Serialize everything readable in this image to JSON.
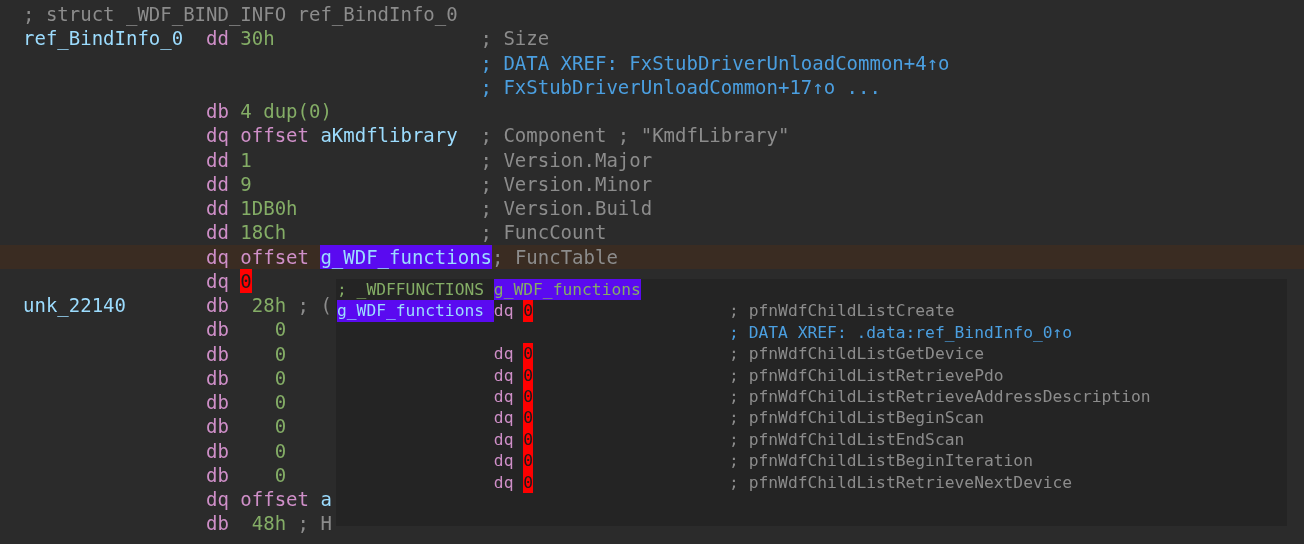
{
  "listing": {
    "lines": [
      {
        "label": {
          "text": "; struct _WDF_BIND_INFO ref_BindInfo_0",
          "kind": "comment"
        }
      },
      {
        "label": {
          "text": "ref_BindInfo_0",
          "kind": "label"
        },
        "mnemonic": "dd",
        "operands": [
          {
            "text": "30h",
            "kind": "number"
          }
        ],
        "comment": {
          "text": "; Size",
          "kind": "comment"
        }
      },
      {
        "comment": {
          "text": "; DATA XREF: FxStubDriverUnloadCommon+4↑o",
          "kind": "xref"
        }
      },
      {
        "comment": {
          "text": "; FxStubDriverUnloadCommon+17↑o ...",
          "kind": "xref"
        }
      },
      {
        "mnemonic": "db",
        "operands": [
          {
            "text": "4 dup(0)",
            "kind": "number"
          }
        ]
      },
      {
        "mnemonic": "dq",
        "operands": [
          {
            "text": "offset",
            "kind": "keyword"
          },
          {
            "text": "aKmdflibrary",
            "kind": "name"
          }
        ],
        "comment": {
          "text": "; Component ; \"KmdfLibrary\"",
          "kind": "comment"
        }
      },
      {
        "mnemonic": "dd",
        "operands": [
          {
            "text": "1",
            "kind": "number"
          }
        ],
        "comment": {
          "text": "; Version.Major",
          "kind": "comment"
        }
      },
      {
        "mnemonic": "dd",
        "operands": [
          {
            "text": "9",
            "kind": "number"
          }
        ],
        "comment": {
          "text": "; Version.Minor",
          "kind": "comment"
        }
      },
      {
        "mnemonic": "dd",
        "operands": [
          {
            "text": "1DB0h",
            "kind": "number"
          }
        ],
        "comment": {
          "text": "; Version.Build",
          "kind": "comment"
        }
      },
      {
        "mnemonic": "dd",
        "operands": [
          {
            "text": "18Ch",
            "kind": "number"
          }
        ],
        "comment": {
          "text": "; FuncCount",
          "kind": "comment"
        }
      },
      {
        "highlighted": true,
        "mnemonic": "dq",
        "operands": [
          {
            "text": "offset",
            "kind": "keyword"
          },
          {
            "text": "g_WDF_functions",
            "kind": "name",
            "selected": true
          }
        ],
        "comment": {
          "text": "; FuncTable",
          "kind": "comment"
        }
      },
      {
        "mnemonic": "dq",
        "operands": [
          {
            "text": "0",
            "kind": "error"
          }
        ]
      },
      {
        "label": {
          "text": "unk_22140",
          "kind": "label"
        },
        "mnemonic": "db",
        "operands": [
          {
            "text": "28h",
            "kind": "byte"
          },
          {
            "text": "; (",
            "kind": "comment"
          }
        ]
      },
      {
        "mnemonic": "db",
        "operands": [
          {
            "text": "0",
            "kind": "byte"
          }
        ]
      },
      {
        "mnemonic": "db",
        "operands": [
          {
            "text": "0",
            "kind": "byte"
          }
        ]
      },
      {
        "mnemonic": "db",
        "operands": [
          {
            "text": "0",
            "kind": "byte"
          }
        ]
      },
      {
        "mnemonic": "db",
        "operands": [
          {
            "text": "0",
            "kind": "byte"
          }
        ]
      },
      {
        "mnemonic": "db",
        "operands": [
          {
            "text": "0",
            "kind": "byte"
          }
        ]
      },
      {
        "mnemonic": "db",
        "operands": [
          {
            "text": "0",
            "kind": "byte"
          }
        ]
      },
      {
        "mnemonic": "db",
        "operands": [
          {
            "text": "0",
            "kind": "byte"
          }
        ]
      },
      {
        "mnemonic": "dq",
        "operands": [
          {
            "text": "offset",
            "kind": "keyword"
          },
          {
            "text": "a",
            "kind": "name"
          }
        ]
      },
      {
        "mnemonic": "db",
        "operands": [
          {
            "text": "48h",
            "kind": "byte"
          },
          {
            "text": "; H",
            "kind": "comment"
          }
        ]
      }
    ]
  },
  "hint": {
    "lines": [
      {
        "label": {
          "text": "; _WDFFUNCTIONS",
          "kind": "comment"
        },
        "operands": [
          {
            "text": "g_WDF_functions",
            "kind": "comment",
            "selected": true
          }
        ]
      },
      {
        "label": {
          "text": "g_WDF_functions",
          "kind": "label",
          "selected": true
        },
        "mnemonic": "dq",
        "operands": [
          {
            "text": "0",
            "kind": "error"
          }
        ],
        "comment": {
          "text": "; pfnWdfChildListCreate",
          "kind": "comment"
        }
      },
      {
        "comment": {
          "text": "; DATA XREF: .data:ref_BindInfo_0↑o",
          "kind": "xref"
        }
      },
      {
        "mnemonic": "dq",
        "operands": [
          {
            "text": "0",
            "kind": "error"
          }
        ],
        "comment": {
          "text": "; pfnWdfChildListGetDevice",
          "kind": "comment"
        }
      },
      {
        "mnemonic": "dq",
        "operands": [
          {
            "text": "0",
            "kind": "error"
          }
        ],
        "comment": {
          "text": "; pfnWdfChildListRetrievePdo",
          "kind": "comment"
        }
      },
      {
        "mnemonic": "dq",
        "operands": [
          {
            "text": "0",
            "kind": "error"
          }
        ],
        "comment": {
          "text": "; pfnWdfChildListRetrieveAddressDescription",
          "kind": "comment"
        }
      },
      {
        "mnemonic": "dq",
        "operands": [
          {
            "text": "0",
            "kind": "error"
          }
        ],
        "comment": {
          "text": "; pfnWdfChildListBeginScan",
          "kind": "comment"
        }
      },
      {
        "mnemonic": "dq",
        "operands": [
          {
            "text": "0",
            "kind": "error"
          }
        ],
        "comment": {
          "text": "; pfnWdfChildListEndScan",
          "kind": "comment"
        }
      },
      {
        "mnemonic": "dq",
        "operands": [
          {
            "text": "0",
            "kind": "error"
          }
        ],
        "comment": {
          "text": "; pfnWdfChildListBeginIteration",
          "kind": "comment"
        }
      },
      {
        "mnemonic": "dq",
        "operands": [
          {
            "text": "0",
            "kind": "error"
          }
        ],
        "comment": {
          "text": "; pfnWdfChildListRetrieveNextDevice",
          "kind": "comment"
        }
      }
    ]
  }
}
